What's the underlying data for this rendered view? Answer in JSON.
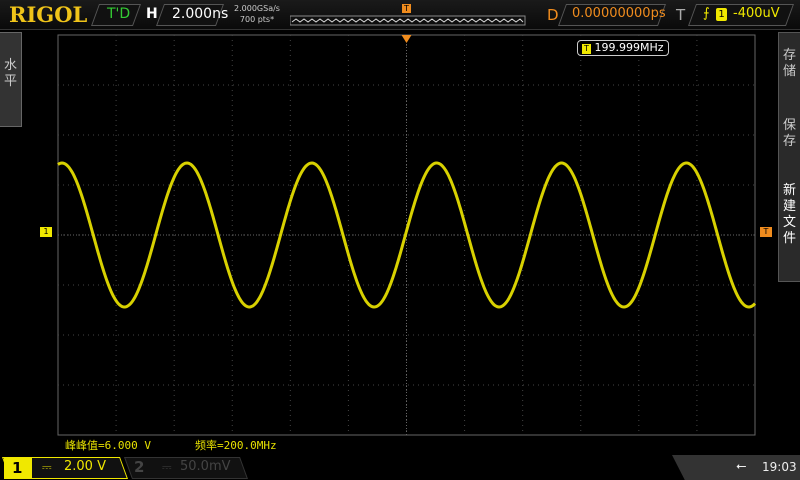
{
  "header": {
    "brand": "RIGOL",
    "run_state": "T'D",
    "h_label": "H",
    "timebase": "2.000ns",
    "sample_rate": "2.000GSa/s",
    "memory_depth": "700  pts*",
    "delay_label": "D",
    "delay": "0.00000000ps",
    "trigger_label": "T",
    "trigger_channel": "1",
    "trigger_level": "-400uV"
  },
  "left_menu": {
    "label": "水平"
  },
  "right_menu": {
    "items": [
      "存储",
      "保存",
      "新建文件"
    ]
  },
  "screen": {
    "freq_counter": "199.999MHz",
    "trigger_marker": "T",
    "ch1_marker": "1",
    "trigger_level_marker": "T"
  },
  "measurements": {
    "vpp": "峰峰值=6.000 V",
    "freq": "频率=200.0MHz"
  },
  "channels": [
    {
      "num": "1",
      "coupling": "⎓",
      "scale": "2.00 V"
    },
    {
      "num": "2",
      "coupling": "⎓",
      "scale": "50.0mV"
    }
  ],
  "status": {
    "time": "19:03"
  },
  "colors": {
    "ch1": "#f0e800",
    "trigger": "#f08c1e",
    "grid": "#555555"
  }
}
